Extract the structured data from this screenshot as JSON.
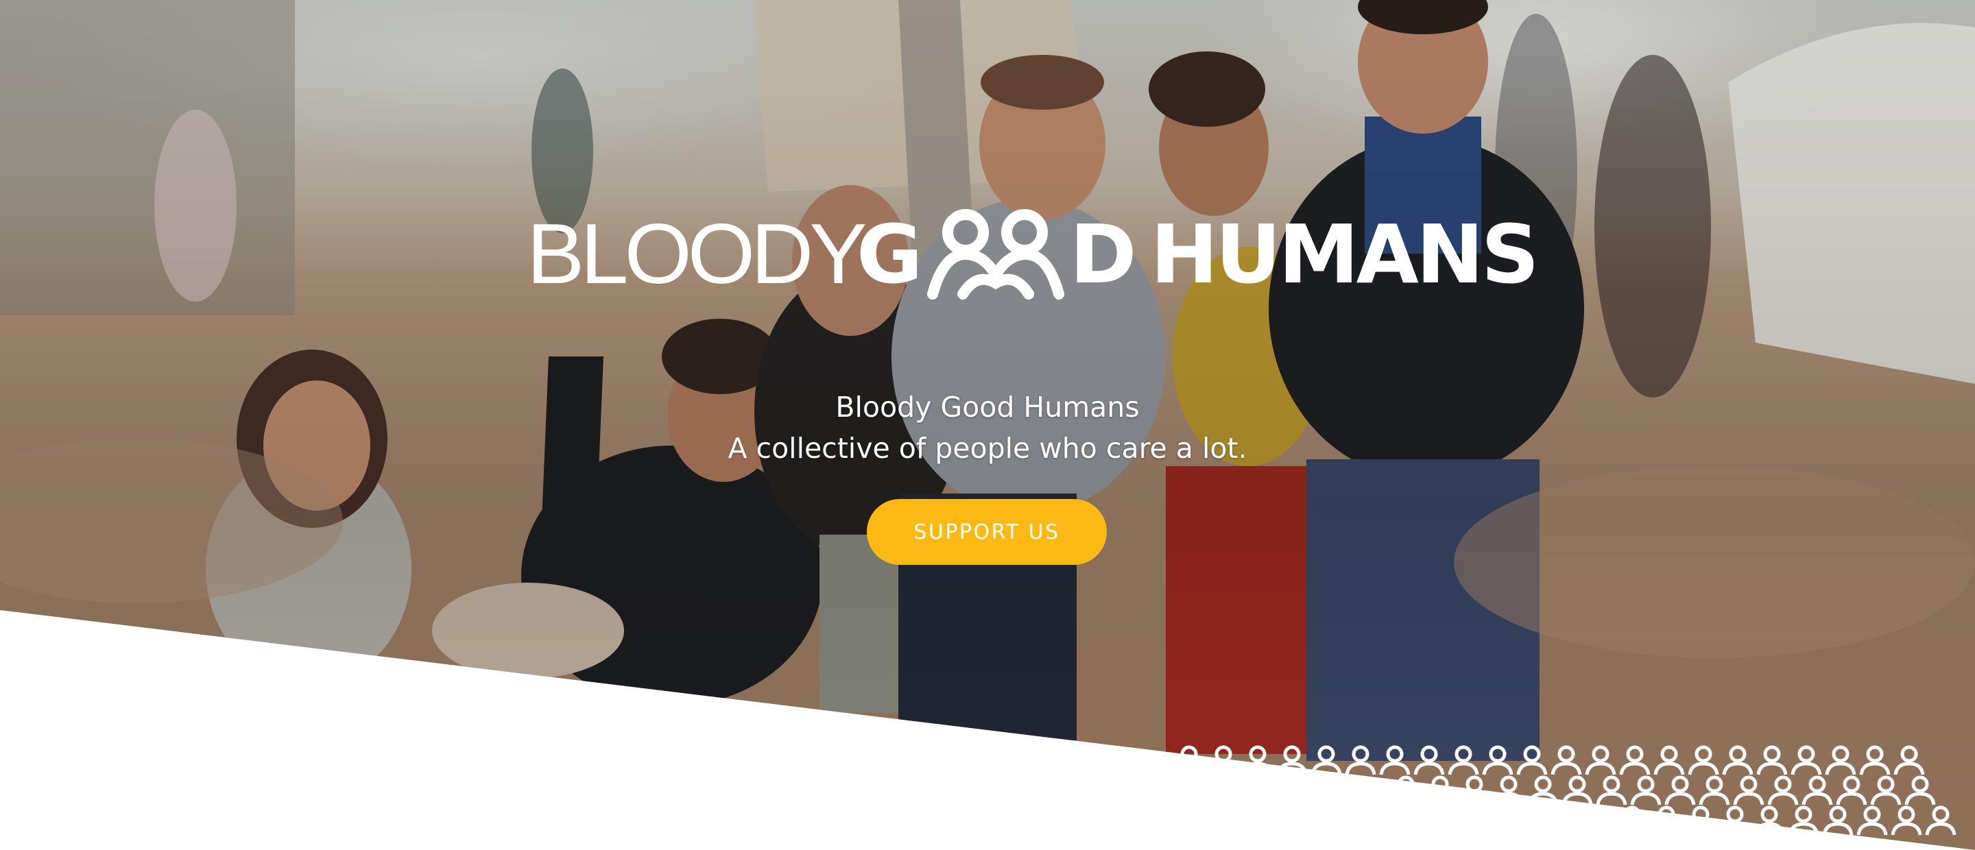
{
  "brand": {
    "logo_light": "BLOODY",
    "logo_bold_1": "G",
    "logo_bold_2": "D",
    "logo_bold_3": "HUMANS",
    "logo_text": "BLOODY GOOD HUMANS"
  },
  "hero": {
    "title": "Bloody Good Humans",
    "subtitle": "A collective of people who care a lot.",
    "cta_label": "SUPPORT US"
  },
  "colors": {
    "accent": "#fdb913",
    "text_on_image": "#ffffff",
    "background": "#ffffff"
  },
  "icons": {
    "logo_mark": "people-figures-icon",
    "decorative_pattern": "people-pattern-icon"
  }
}
